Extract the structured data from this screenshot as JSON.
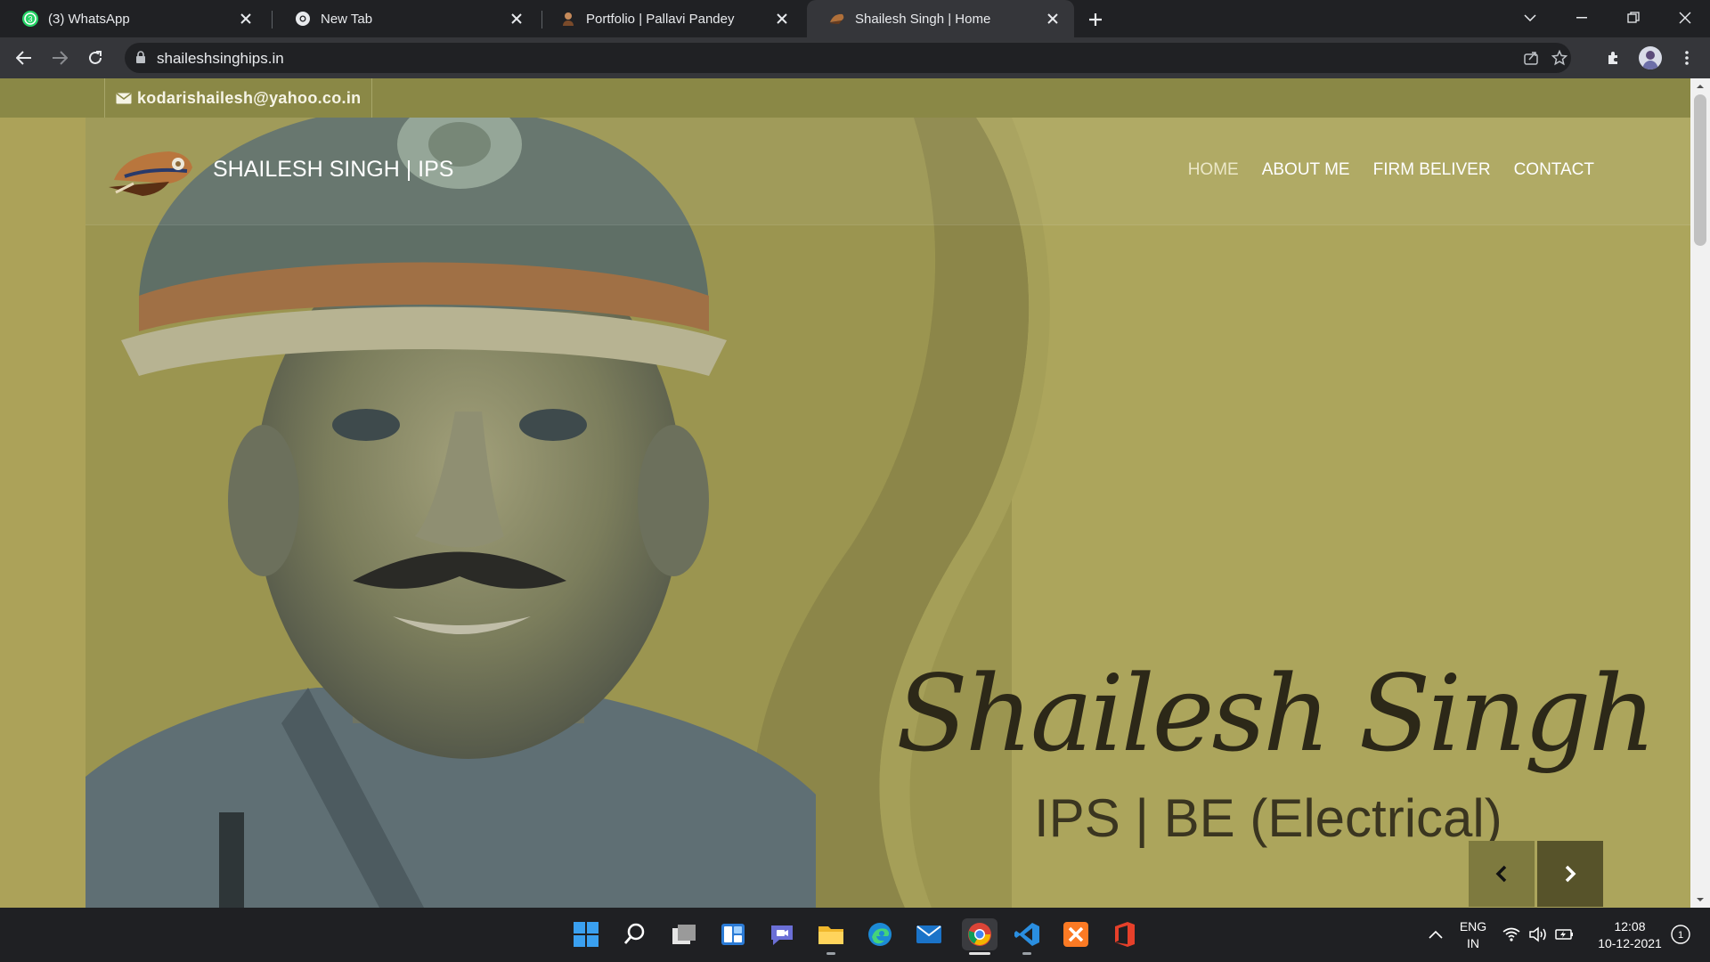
{
  "browser": {
    "tabs": [
      {
        "title": "(3) WhatsApp",
        "badge": "3",
        "active": false
      },
      {
        "title": "New Tab",
        "active": false
      },
      {
        "title": "Portfolio | Pallavi Pandey",
        "active": false
      },
      {
        "title": "Shailesh Singh | Home",
        "active": true
      }
    ],
    "url": "shaileshsinghips.in"
  },
  "site": {
    "email": "kodarishailesh@yahoo.co.in",
    "brand": "SHAILESH SINGH | IPS",
    "nav": [
      {
        "label": "HOME",
        "active": true
      },
      {
        "label": "ABOUT ME"
      },
      {
        "label": "FIRM BELIVER"
      },
      {
        "label": "CONTACT"
      }
    ],
    "hero": {
      "name": "Shailesh Singh",
      "subtitle": "IPS | BE (Electrical)"
    }
  },
  "taskbar": {
    "language": "ENG",
    "region": "IN",
    "time": "12:08",
    "date": "10-12-2021",
    "notifications": "1"
  },
  "colors": {
    "page_bg": "#aca259",
    "topbar": "#8a8846",
    "hero_text": "#2c2818"
  }
}
